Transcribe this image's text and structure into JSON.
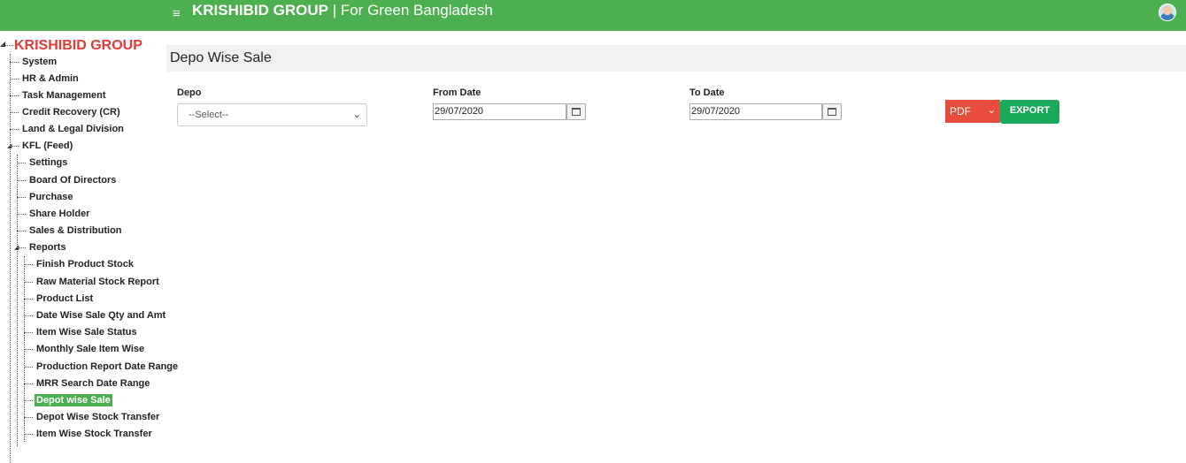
{
  "header": {
    "brand": "KRISHIBID GROUP",
    "separator": " | ",
    "tagline": "For Green Bangladesh",
    "menu_icon": "≡"
  },
  "sidebar": {
    "brand": "KRISHIBID GROUP",
    "top_items": [
      "System",
      "HR & Admin",
      "Task Management",
      "Credit Recovery (CR)",
      "Land & Legal Division",
      "KFL (Feed)"
    ],
    "kfl_items": [
      "Settings",
      "Board Of Directors",
      "Purchase",
      "Share Holder",
      "Sales & Distribution",
      "Reports"
    ],
    "report_items": [
      "Finish Product Stock",
      "Raw Material Stock Report",
      "Product List",
      "Date Wise Sale Qty and Amt",
      "Item Wise Sale Status",
      "Monthly Sale Item Wise",
      "Production Report Date Range",
      "MRR Search Date Range",
      "Depot wise Sale",
      "Depot Wise Stock Transfer",
      "Item Wise Stock Transfer"
    ],
    "active_item": "Depot wise Sale"
  },
  "page": {
    "title": "Depo Wise Sale",
    "depo_label": "Depo",
    "depo_value": "--Select--",
    "from_label": "From Date",
    "from_value": "29/07/2020",
    "to_label": "To Date",
    "to_value": "29/07/2020",
    "format_value": "PDF",
    "export_label": "EXPORT"
  },
  "colors": {
    "topbar": "#4caf50",
    "brand_red": "#e53935",
    "pdf": "#e74c3c",
    "export": "#1aa85a"
  }
}
